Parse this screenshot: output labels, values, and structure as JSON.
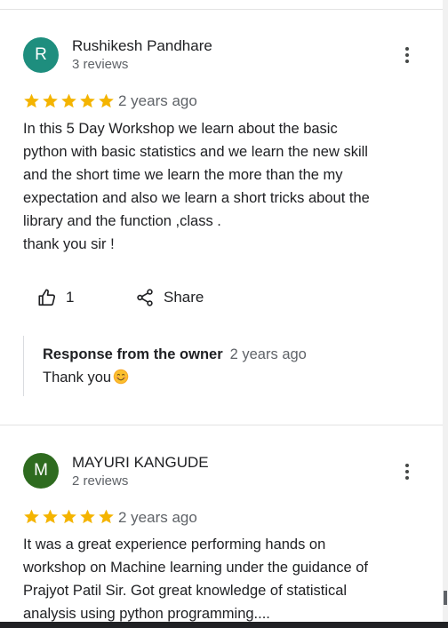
{
  "reviews": [
    {
      "avatar_letter": "R",
      "avatar_color": "#1e8e7e",
      "name": "Rushikesh Pandhare",
      "review_count": "3 reviews",
      "rating": 5,
      "date": "2 years ago",
      "text": "In this 5 Day Workshop we learn about the basic\npython with basic statistics and we learn the new skill\nand the short time we learn the more than the  my\nexpectation and also we learn a short tricks about the\nlibrary and the function ,class .\nthank you sir !",
      "like_count": "1",
      "share_label": "Share",
      "owner_response": {
        "title": "Response from the owner",
        "date": "2 years ago",
        "text": "Thank you",
        "emoji": "smiling-face-icon"
      }
    },
    {
      "avatar_letter": "M",
      "avatar_color": "#2e6b1f",
      "name": "MAYURI KANGUDE",
      "review_count": "2 reviews",
      "rating": 5,
      "date": "2 years ago",
      "text": "It was a great experience performing hands on\nworkshop on Machine learning under the guidance of\nPrajyot Patil Sir. Got great knowledge of statistical\nanalysis using python programming...."
    }
  ],
  "colors": {
    "star": "#f4b400"
  }
}
